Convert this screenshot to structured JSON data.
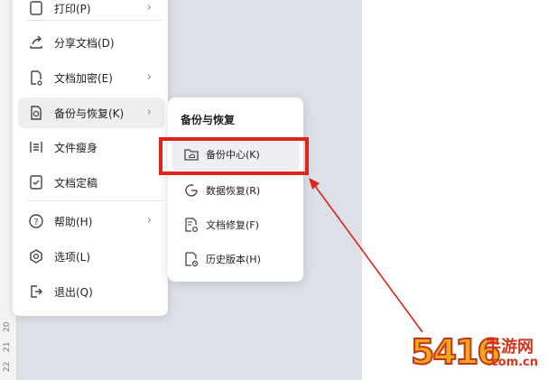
{
  "ruler": {
    "numbers": [
      "20",
      "21",
      "22"
    ]
  },
  "main_menu": {
    "items": [
      {
        "id": "print",
        "label": "打印(P)",
        "icon": "printer-icon",
        "has_submenu": true
      },
      {
        "id": "share",
        "label": "分享文档(D)",
        "icon": "share-icon",
        "has_submenu": false
      },
      {
        "id": "encrypt",
        "label": "文档加密(E)",
        "icon": "lock-document-icon",
        "has_submenu": true
      },
      {
        "id": "backup",
        "label": "备份与恢复(K)",
        "icon": "backup-icon",
        "has_submenu": true,
        "active": true
      },
      {
        "id": "slim",
        "label": "文件瘦身",
        "icon": "compress-icon",
        "has_submenu": false
      },
      {
        "id": "finalize",
        "label": "文档定稿",
        "icon": "check-document-icon",
        "has_submenu": false
      },
      {
        "id": "help",
        "label": "帮助(H)",
        "icon": "help-icon",
        "has_submenu": true
      },
      {
        "id": "options",
        "label": "选项(L)",
        "icon": "settings-icon",
        "has_submenu": false
      },
      {
        "id": "exit",
        "label": "退出(Q)",
        "icon": "exit-icon",
        "has_submenu": false
      }
    ]
  },
  "sub_menu": {
    "title": "备份与恢复",
    "items": [
      {
        "id": "backup_center",
        "label": "备份中心(K)",
        "icon": "cloud-folder-icon",
        "highlighted": true
      },
      {
        "id": "data_recovery",
        "label": "数据恢复(R)",
        "icon": "recovery-icon"
      },
      {
        "id": "doc_repair",
        "label": "文档修复(F)",
        "icon": "repair-document-icon"
      },
      {
        "id": "history",
        "label": "历史版本(H)",
        "icon": "history-icon"
      }
    ]
  },
  "annotation": {
    "color": "#e0241b"
  },
  "watermark": {
    "number": "5416",
    "text": "手游网",
    "domain": ".com.cn"
  }
}
